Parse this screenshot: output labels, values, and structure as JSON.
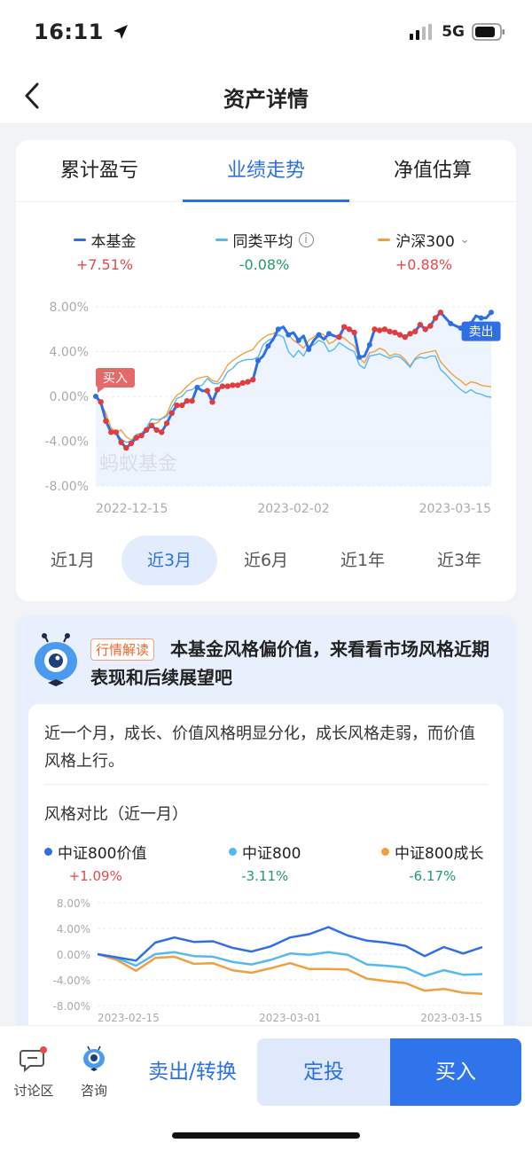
{
  "status": {
    "time": "16:11",
    "network": "5G"
  },
  "nav": {
    "title": "资产详情"
  },
  "tabs": [
    {
      "label": "累计盈亏",
      "active": false
    },
    {
      "label": "业绩走势",
      "active": true
    },
    {
      "label": "净值估算",
      "active": false
    }
  ],
  "legend": [
    {
      "name": "本基金",
      "value": "+7.51%",
      "color": "#2f6fe4"
    },
    {
      "name": "同类平均",
      "value": "-0.08%",
      "color": "#55b8f0"
    },
    {
      "name": "沪深300",
      "value": "+0.88%",
      "color": "#f0a040"
    }
  ],
  "chart_data": [
    {
      "type": "line",
      "ylim": [
        -8,
        8
      ],
      "y_ticks": [
        "8.00%",
        "4.00%",
        "0.00%",
        "-4.00%",
        "-8.00%"
      ],
      "x_ticks": [
        "2022-12-15",
        "2023-02-02",
        "2023-03-15"
      ],
      "grid": true,
      "watermark": "蚂蚁基金",
      "annotations": {
        "buy_label": "买入",
        "sell_label": "卖出"
      },
      "series": [
        {
          "name": "本基金",
          "color": "#2f6fe4",
          "values": [
            0,
            -0.5,
            -2.2,
            -3.2,
            -3.2,
            -4.1,
            -4.6,
            -4.2,
            -3.7,
            -3.5,
            -3.0,
            -2.6,
            -3.0,
            -3.2,
            -2.4,
            -1.5,
            -0.8,
            -0.8,
            -0.4,
            -0.4,
            0.8,
            0.5,
            0.5,
            -0.5,
            0.6,
            0.9,
            0.9,
            1.0,
            1.0,
            1.2,
            1.3,
            1.5,
            3.2,
            3.6,
            4.5,
            5.1,
            6.0,
            6.2,
            5.5,
            5.7,
            5.0,
            5.4,
            4.2,
            5.0,
            5.5,
            5.1,
            5.6,
            5.4,
            5.3,
            6.2,
            6.0,
            5.7,
            3.5,
            3.6,
            4.6,
            6.0,
            5.9,
            6.0,
            5.8,
            5.7,
            5.5,
            5.3,
            5.6,
            5.8,
            6.4,
            6.0,
            6.3,
            7.0,
            7.5,
            7.0,
            6.5,
            6.3,
            6.1,
            6.3,
            6.5,
            7.2,
            7.0,
            7.0,
            7.5
          ]
        },
        {
          "name": "同类平均",
          "color": "#55b8f0",
          "values": [
            0,
            -0.8,
            -2.2,
            -3.0,
            -3.3,
            -3.8,
            -4.1,
            -4.0,
            -3.4,
            -3.3,
            -2.8,
            -2.0,
            -2.1,
            -2.0,
            -1.8,
            -1.0,
            -0.2,
            0.0,
            0.5,
            0.6,
            0.9,
            1.0,
            1.6,
            1.2,
            1.1,
            1.4,
            2.2,
            2.5,
            3.0,
            3.2,
            3.3,
            3.3,
            3.5,
            4.6,
            5.0,
            5.2,
            5.5,
            5.3,
            4.0,
            3.5,
            4.1,
            3.6,
            4.5,
            4.6,
            5.0,
            4.8,
            4.0,
            4.2,
            4.8,
            4.5,
            4.2,
            4.0,
            2.8,
            2.5,
            3.6,
            3.7,
            3.8,
            3.6,
            3.4,
            3.6,
            3.5,
            3.1,
            2.6,
            3.3,
            3.5,
            3.4,
            3.6,
            3.6,
            2.4,
            2.0,
            1.5,
            1.0,
            0.6,
            0.3,
            0.6,
            0.3,
            0.2,
            0.0,
            -0.08
          ]
        },
        {
          "name": "沪深300",
          "color": "#f0a040",
          "values": [
            0,
            -0.6,
            -1.5,
            -2.8,
            -3.2,
            -3.0,
            -3.6,
            -3.9,
            -3.5,
            -3.5,
            -3.0,
            -2.4,
            -2.4,
            -2.0,
            -1.6,
            -0.5,
            0.1,
            0.4,
            0.9,
            1.3,
            1.6,
            1.7,
            1.8,
            1.4,
            1.3,
            2.0,
            2.8,
            3.2,
            3.5,
            3.8,
            4.0,
            4.2,
            4.8,
            5.2,
            5.5,
            5.6,
            5.9,
            6.3,
            5.5,
            5.0,
            4.7,
            4.3,
            5.0,
            5.3,
            5.7,
            5.5,
            4.7,
            4.9,
            5.4,
            5.2,
            4.8,
            4.5,
            3.4,
            3.0,
            3.9,
            4.0,
            4.3,
            4.1,
            3.6,
            3.8,
            3.7,
            3.3,
            2.7,
            3.4,
            3.8,
            3.9,
            4.0,
            4.1,
            3.1,
            2.6,
            2.1,
            1.7,
            1.4,
            1.0,
            1.3,
            1.2,
            1.0,
            0.9,
            0.88
          ]
        }
      ]
    },
    {
      "type": "line",
      "ylim": [
        -8,
        8
      ],
      "y_ticks": [
        "8.00%",
        "4.00%",
        "0.00%",
        "-4.00%",
        "-8.00%"
      ],
      "x_ticks": [
        "2023-02-15",
        "2023-03-01",
        "2023-03-15"
      ],
      "grid": true,
      "series": [
        {
          "name": "中证800价值",
          "color": "#2f6fe4",
          "values": [
            0,
            -0.5,
            -1.0,
            1.8,
            2.6,
            1.9,
            2.0,
            1.0,
            0.4,
            1.2,
            2.6,
            3.1,
            4.2,
            2.9,
            2.1,
            1.8,
            1.3,
            -0.3,
            1.1,
            0.1,
            1.09
          ]
        },
        {
          "name": "中证800",
          "color": "#55b8f0",
          "values": [
            0,
            -0.6,
            -1.8,
            0.0,
            0.3,
            -0.3,
            -0.4,
            -1.2,
            -1.6,
            -0.9,
            0.1,
            -0.1,
            0.3,
            -0.1,
            -1.6,
            -1.8,
            -2.1,
            -3.4,
            -2.5,
            -3.2,
            -3.11
          ]
        },
        {
          "name": "中证800成长",
          "color": "#f0a040",
          "values": [
            0,
            -0.9,
            -2.6,
            -0.6,
            -0.4,
            -1.5,
            -1.4,
            -2.5,
            -2.9,
            -2.2,
            -1.4,
            -2.3,
            -2.3,
            -2.4,
            -3.8,
            -4.2,
            -4.5,
            -5.7,
            -5.4,
            -6.0,
            -6.17
          ]
        }
      ]
    }
  ],
  "periods": [
    {
      "label": "近1月",
      "active": false
    },
    {
      "label": "近3月",
      "active": true
    },
    {
      "label": "近6月",
      "active": false
    },
    {
      "label": "近1年",
      "active": false
    },
    {
      "label": "近3年",
      "active": false
    }
  ],
  "insight": {
    "tag": "行情解读",
    "headline": "本基金风格偏价值，来看看市场风格近期表现和后续展望吧",
    "body": "近一个月，成长、价值风格明显分化，成长风格走弱，而价值风格上行。",
    "style_title": "风格对比（近一月）",
    "legend": [
      {
        "name": "中证800价值",
        "value": "+1.09%",
        "color": "#2f6fe4"
      },
      {
        "name": "中证800",
        "value": "-3.11%",
        "color": "#55b8f0"
      },
      {
        "name": "中证800成长",
        "value": "-6.17%",
        "color": "#f0a040"
      }
    ]
  },
  "bottom": {
    "discuss_label": "讨论区",
    "consult_label": "咨询",
    "sell_label": "卖出/转换",
    "dca_label": "定投",
    "buy_label": "买入"
  }
}
